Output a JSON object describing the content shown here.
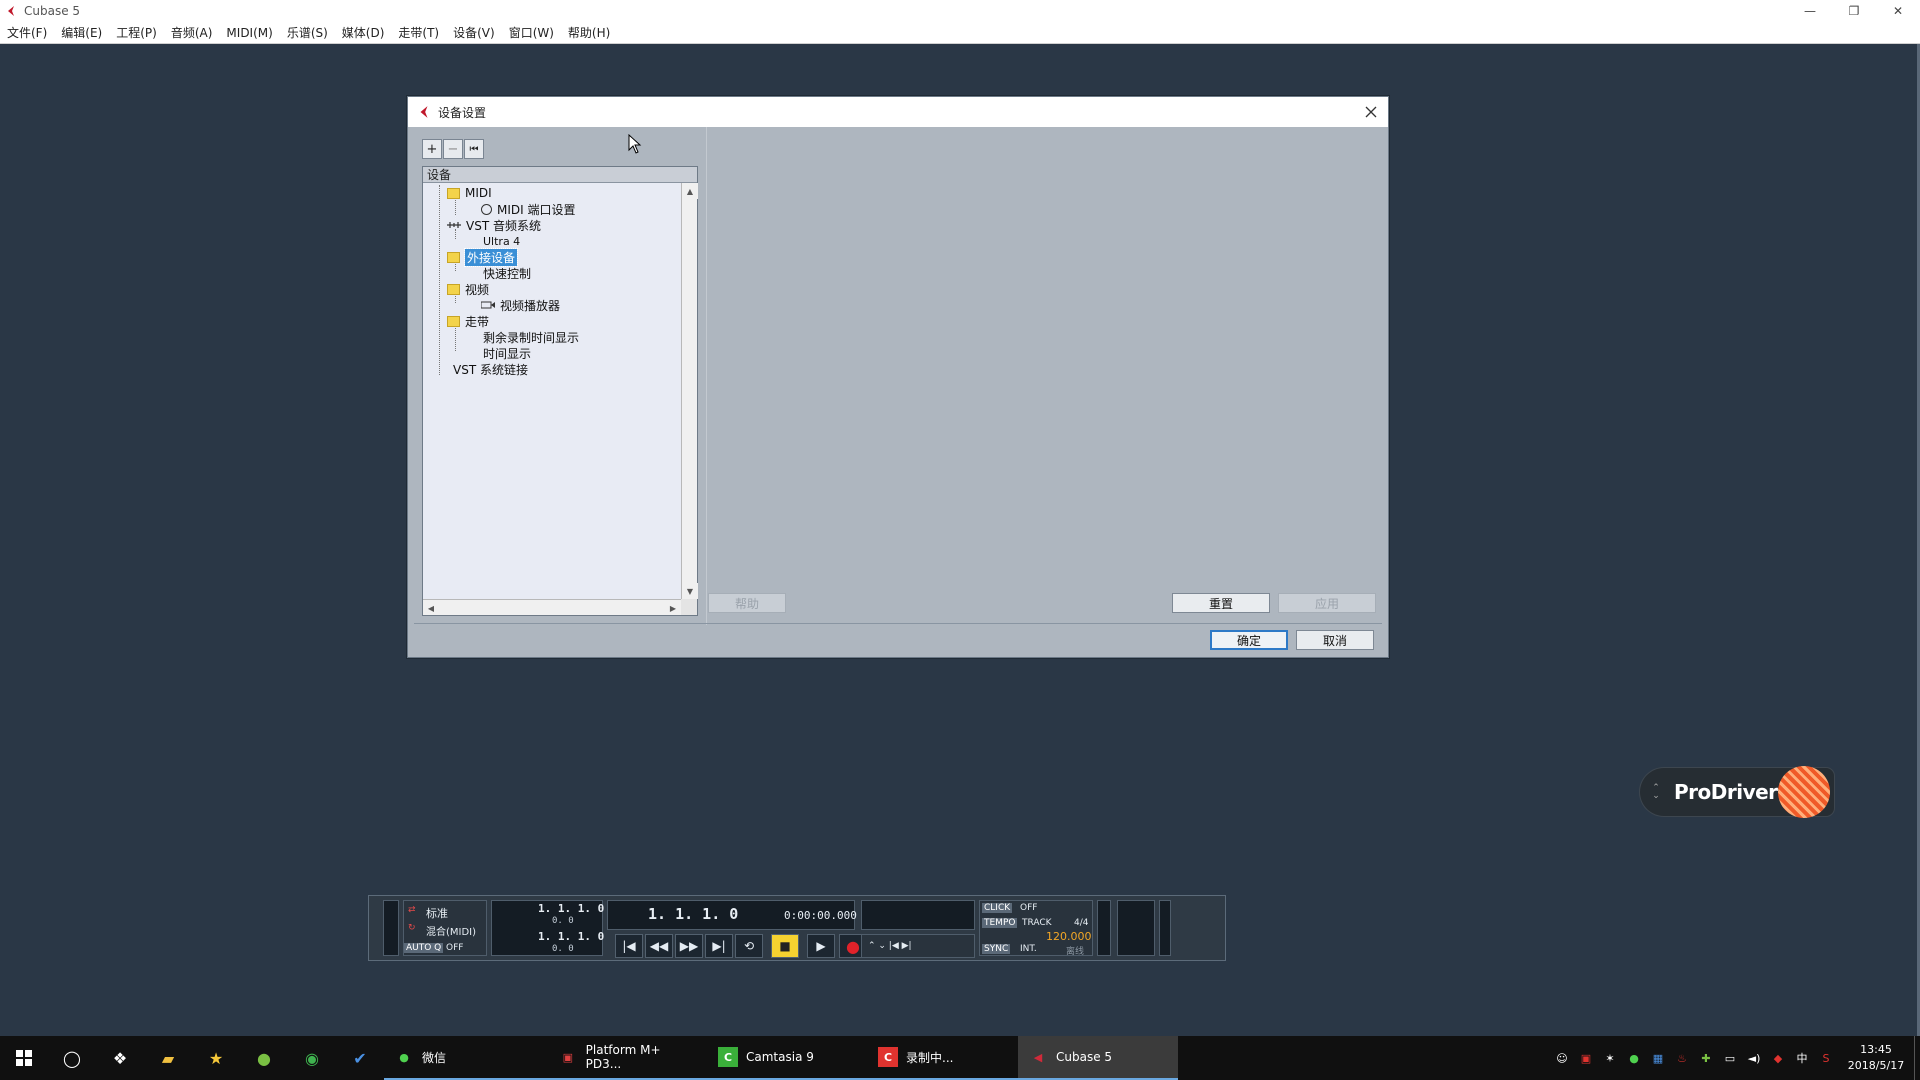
{
  "window": {
    "title": "Cubase 5",
    "min": "—",
    "restore": "❐",
    "close": "✕"
  },
  "menu": [
    "文件(F)",
    "编辑(E)",
    "工程(P)",
    "音频(A)",
    "MIDI(M)",
    "乐谱(S)",
    "媒体(D)",
    "走带(T)",
    "设备(V)",
    "窗口(W)",
    "帮助(H)"
  ],
  "dialog": {
    "title": "设备设置",
    "toolbar": {
      "add": "+",
      "remove": "−",
      "reset": "⏮"
    },
    "tree_header": "设备",
    "tree": [
      {
        "label": "MIDI",
        "icon": "folder-icon"
      },
      {
        "label": "MIDI 端口设置",
        "icon": "midi-port-icon"
      },
      {
        "label": "VST 音频系统",
        "icon": "vst-audio-icon"
      },
      {
        "label": "Ultra 4",
        "icon": ""
      },
      {
        "label": "外接设备",
        "icon": "folder-icon",
        "selected": true
      },
      {
        "label": "快速控制",
        "icon": ""
      },
      {
        "label": "视频",
        "icon": "folder-icon"
      },
      {
        "label": "视频播放器",
        "icon": "video-player-icon"
      },
      {
        "label": "走带",
        "icon": "folder-icon"
      },
      {
        "label": "剩余录制时间显示",
        "icon": ""
      },
      {
        "label": "时间显示",
        "icon": ""
      },
      {
        "label": "VST 系统链接",
        "icon": ""
      }
    ],
    "buttons": {
      "help": "帮助",
      "reset": "重置",
      "apply": "应用",
      "ok": "确定",
      "cancel": "取消"
    }
  },
  "badge": {
    "text": "ProDriver"
  },
  "transport": {
    "mode1": "标准",
    "mode2": "混合(MIDI)",
    "auto_q": "AUTO Q",
    "auto_q_value": "OFF",
    "left_locator": "1. 1. 1.    0",
    "left_locator_sub": "0.    0",
    "right_locator": "1. 1. 1.    0",
    "right_locator_sub": "0.    0",
    "primary_position": "1. 1. 1.    0",
    "secondary_position": "0:00:00.000",
    "click_label": "CLICK",
    "click_value": "OFF",
    "tempo_label": "TEMPO",
    "track_label": "TRACK",
    "signature": "4/4",
    "tempo_value": "120.000",
    "sync_label": "SYNC",
    "sync_value": "INT.",
    "offline": "离线"
  },
  "taskbar": {
    "apps": [
      {
        "label": "微信",
        "icon": "wechat-icon"
      },
      {
        "label": "Platform M+ PD3...",
        "icon": "pdf-icon"
      },
      {
        "label": "Camtasia 9",
        "icon": "camtasia-icon"
      },
      {
        "label": "录制中...",
        "icon": "recorder-icon"
      },
      {
        "label": "Cubase 5",
        "icon": "cubase-icon"
      }
    ],
    "ime": "中",
    "time": "13:45",
    "date": "2018/5/17"
  },
  "colors": {
    "workspace": "#2a3746",
    "dialog_bg": "#aeb6bf",
    "selection": "#3a8fd6",
    "accent": "#f05a28",
    "stop_button": "#f6d230",
    "record": "#e0222a",
    "tempo_value": "#f3a726"
  }
}
